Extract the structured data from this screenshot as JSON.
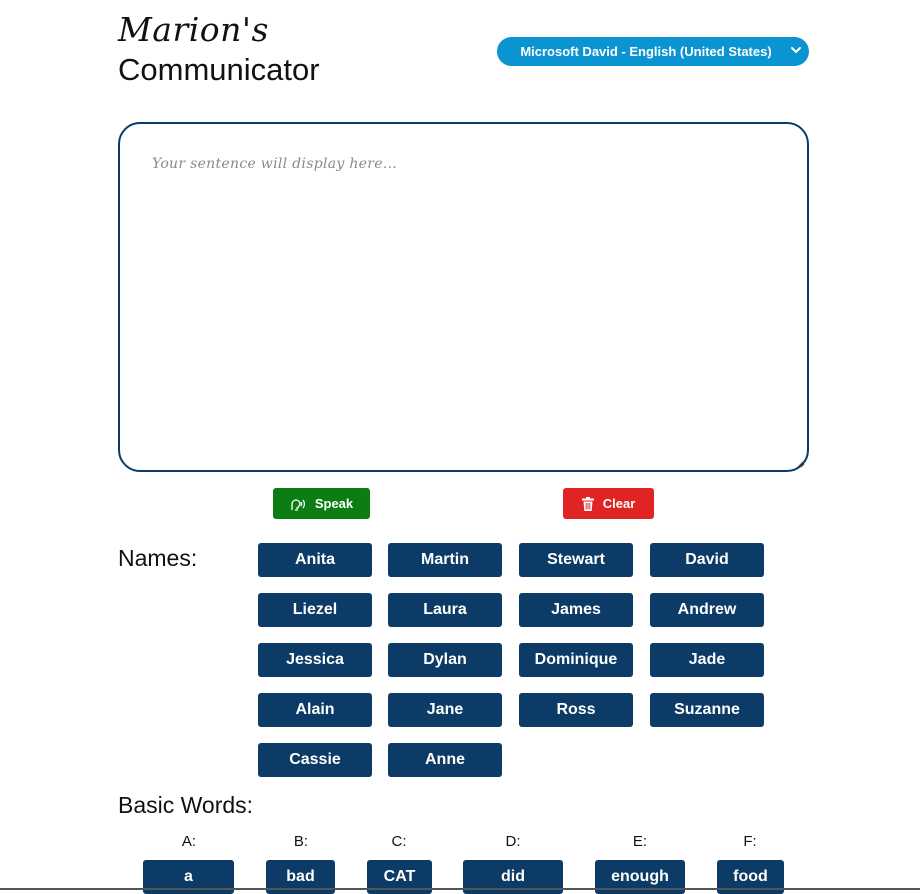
{
  "header": {
    "title_script": "Marion's",
    "title_main": "Communicator",
    "voice_select_value": "Microsoft David - English (United States)"
  },
  "sentence": {
    "placeholder": "Your sentence will display here...",
    "value": ""
  },
  "actions": {
    "speak_label": "Speak",
    "clear_label": "Clear"
  },
  "names": {
    "label": "Names:",
    "items": [
      "Anita",
      "Martin",
      "Stewart",
      "David",
      "Liezel",
      "Laura",
      "James",
      "Andrew",
      "Jessica",
      "Dylan",
      "Dominique",
      "Jade",
      "Alain",
      "Jane",
      "Ross",
      "Suzanne",
      "Cassie",
      "Anne"
    ]
  },
  "basic_words": {
    "label": "Basic Words:",
    "letters": [
      "A:",
      "B:",
      "C:",
      "D:",
      "E:",
      "F:"
    ],
    "first_words": [
      "a",
      "bad",
      "CAT",
      "did",
      "enough",
      "food"
    ]
  },
  "colors": {
    "accent_blue": "#0b3b66",
    "select_blue": "#0a94d1",
    "speak_green": "#0b7d12",
    "clear_red": "#e02424"
  },
  "icons": {
    "speak": "speaking-head-icon",
    "clear": "trash-icon",
    "select": "chevron-down-icon"
  }
}
